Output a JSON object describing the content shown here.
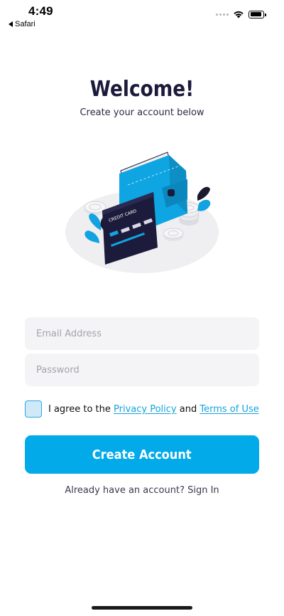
{
  "status_bar": {
    "time": "4:49",
    "back_app": "Safari"
  },
  "header": {
    "title": "Welcome!",
    "subtitle": "Create your account below"
  },
  "illustration": {
    "card_label": "CREDIT CARD",
    "icon": "wallet-credit-card-illustration"
  },
  "form": {
    "email_placeholder": "Email Address",
    "password_placeholder": "Password"
  },
  "agreement": {
    "prefix": "I agree to the ",
    "privacy_link": "Privacy Policy",
    "and": " and ",
    "terms_link": "Terms of Use",
    "checked": false
  },
  "actions": {
    "create_account": "Create Account",
    "signin_prefix": "Already have an account? ",
    "signin_link": "Sign In"
  },
  "colors": {
    "accent": "#02aae9",
    "heading": "#1b1a3a",
    "field_bg": "#f4f4f6",
    "link": "#14a3df"
  }
}
